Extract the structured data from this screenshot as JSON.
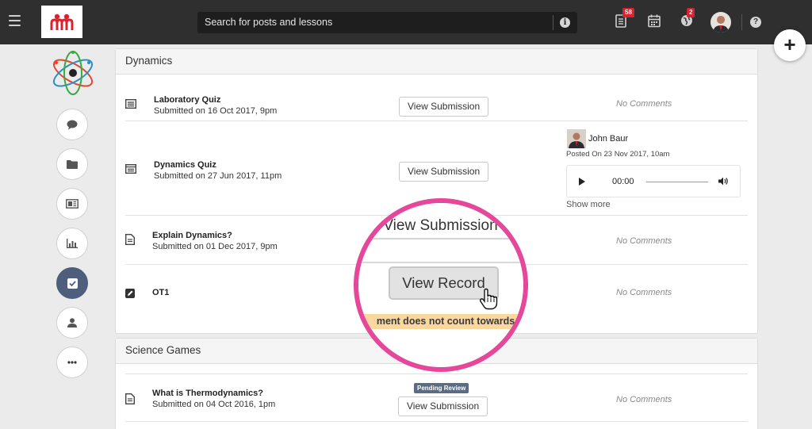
{
  "topbar": {
    "search_placeholder": "Search for posts and lessons",
    "notifications_badge": "58",
    "mail_badge": "2"
  },
  "sections": [
    {
      "title": "Dynamics",
      "rows": [
        {
          "title": "Laboratory Quiz",
          "subtitle": "Submitted on 16 Oct 2017, 9pm",
          "button": "View Submission",
          "comment": "No Comments"
        },
        {
          "title": "Dynamics Quiz",
          "subtitle": "Submitted on 27 Jun 2017, 11pm",
          "button": "View Submission",
          "comment_author": "John Baur",
          "comment_date": "Posted On 23 Nov 2017, 10am",
          "audio_time": "00:00",
          "show_more": "Show more"
        },
        {
          "title": "Explain Dynamics?",
          "subtitle": "Submitted on 01 Dec 2017, 9pm",
          "comment": "No Comments"
        },
        {
          "title": "OT1",
          "comment": "No Comments"
        }
      ]
    },
    {
      "title": "Science Games",
      "rows": [
        {
          "title": "What is Thermodynamics?",
          "subtitle": "Submitted on 04 Oct 2016, 1pm",
          "badge": "Pending Review",
          "button": "View Submission",
          "comment": "No Comments"
        }
      ]
    }
  ],
  "magnifier": {
    "top_button": "View Submission",
    "record_button": "View Record",
    "warning": "ment does not count towards"
  },
  "colors": {
    "topbar": "#2f2f2f",
    "accent_pink": "#e5479a",
    "badge_red": "#d7232f",
    "active_rail": "#4e5f7d"
  },
  "icons": {
    "rail": [
      "chat-icon",
      "folder-icon",
      "newspaper-icon",
      "chart-icon",
      "checkbox-icon",
      "user-icon",
      "more-icon"
    ]
  }
}
